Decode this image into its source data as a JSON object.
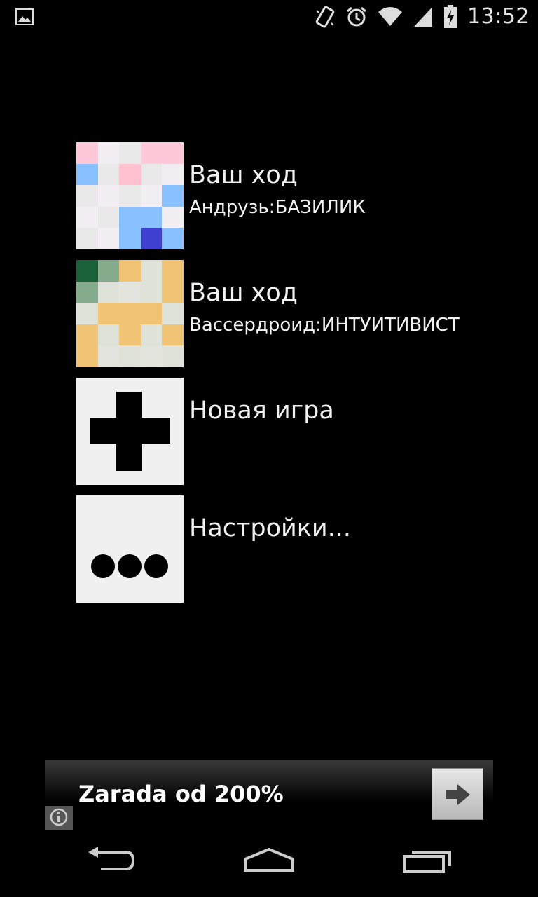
{
  "status_bar": {
    "time": "13:52",
    "icons": [
      "gallery-icon",
      "vibrate-icon",
      "alarm-icon",
      "wifi-icon",
      "signal-icon",
      "battery-charging-icon"
    ]
  },
  "games": [
    {
      "title": "Ваш ход",
      "subtitle": "Андрузь:БАЗИЛИК",
      "thumb_colors": [
        "#ffc8d8",
        "#f2eef4",
        "#e9e9e9",
        "#ffc8d8",
        "#ffc8d8",
        "#89c0ff",
        "#e9e9e9",
        "#ffc0d0",
        "#e9e9e9",
        "#f2eef4",
        "#e9e9e9",
        "#f2eef4",
        "#e9e9e9",
        "#f2eef4",
        "#89c0ff",
        "#f2eef4",
        "#e9e9e9",
        "#89c0ff",
        "#89c0ff",
        "#f2eef4",
        "#e9e9e9",
        "#f2eef4",
        "#89c0ff",
        "#4040d0",
        "#89c0ff"
      ]
    },
    {
      "title": "Ваш ход",
      "subtitle": "Вассердроид:ИНТУИТИВИСТ",
      "thumb_colors": [
        "#1a6038",
        "#84ab8c",
        "#f0c474",
        "#dfe2d8",
        "#f0c474",
        "#84ab8c",
        "#dfe2d8",
        "#e4e4de",
        "#dfe2d8",
        "#f0c474",
        "#dfe2d8",
        "#f0c474",
        "#f0c474",
        "#f0c474",
        "#dfe2d8",
        "#f0c474",
        "#dfe2d8",
        "#f0c474",
        "#dfe2d8",
        "#f0c474",
        "#f0c474",
        "#e4e4de",
        "#dfe2d8",
        "#e4e4de",
        "#dfe2d8"
      ]
    }
  ],
  "actions": {
    "new_game": "Новая игра",
    "settings": "Настройки..."
  },
  "ad": {
    "text": "Zarada od 200%"
  },
  "nav": {
    "icons": [
      "back-icon",
      "home-icon",
      "recent-apps-icon"
    ]
  }
}
